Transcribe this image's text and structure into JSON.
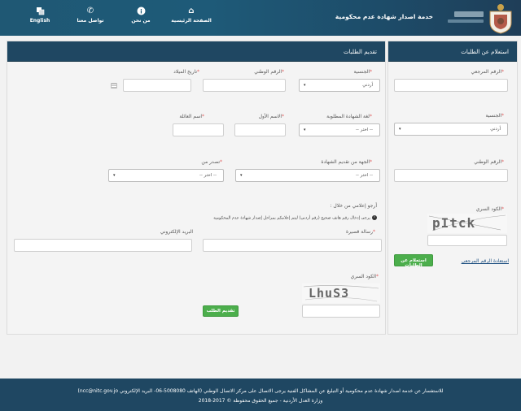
{
  "header": {
    "site_title": "خدمة اصدار شهادة عدم محكومية",
    "nav": [
      {
        "label": "English",
        "icon": "language-icon"
      },
      {
        "label": "تواصل معنا",
        "icon": "phone-icon"
      },
      {
        "label": "من نحن",
        "icon": "info-icon"
      },
      {
        "label": "الصفحة الرئيسية",
        "icon": "home-icon"
      }
    ]
  },
  "inquiry_panel": {
    "title": "استعلام عن الطلبات",
    "reference_label": "الرقم المرجعي",
    "nationality_label": "الجنسية",
    "nationality_value": "أردني",
    "national_id_label": "الرقم الوطني",
    "captcha_label": "الكود السري",
    "captcha_text": "pItck",
    "inquire_button": "استعلام عن الطلبات",
    "forgot_link": "استعادة الرقم المرجعي"
  },
  "application_panel": {
    "title": "تقديم الطلبات",
    "nationality_label": "الجنسية",
    "nationality_value": "أردني",
    "national_id_label": "الرقم الوطني",
    "birth_date_label": "تاريخ الميلاد",
    "cert_language_label": "لغة الشهادة المطلوبة",
    "cert_language_value": "-- اختر --",
    "first_name_label": "الاسم الأول",
    "family_name_label": "اسم العائلة",
    "submit_to_label": "الجهة من تقديم الشهادة",
    "submit_to_value": "-- اختر --",
    "purpose_label": "تصدر من",
    "purpose_value": "-- اختر --",
    "notify_heading": "أرجو إعلامي من خلال :",
    "notify_note": "يرجى إدخال رقم هاتف صحيح (رقم أردني) ليتم إعلامكم بمراحل إصدار شهادة عدم المحكومية",
    "sms_label": "رسالة قصيرة",
    "email_label": "البريد الإلكتروني",
    "captcha_label": "الكود السري",
    "captcha_text": "LhuS3",
    "submit_button": "تقديم الطلب"
  },
  "footer": {
    "line1": "للاستفسار عن خدمة اصدار شهادة عدم محكومية أو التبليغ عن المشاكل الفنية يرجى الاتصال على مركز الاتصال الوطني (الهاتف 5008080-06- البريد الإلكتروني ncc@nitc.gov.jo)",
    "line2": "وزارة العدل الأردنية - جميع الحقوق محفوظة © 2017-2018"
  },
  "colors": {
    "header_bg": "#1f5874",
    "panel_head_bg": "#1f4762",
    "button_green": "#4cae4c",
    "required_star": "#e06060"
  }
}
